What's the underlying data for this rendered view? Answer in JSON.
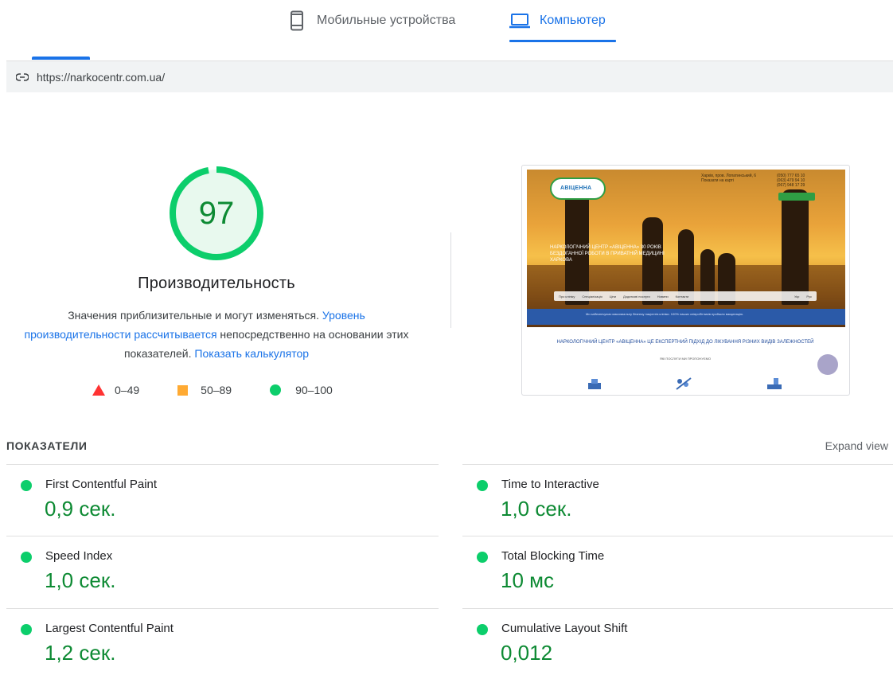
{
  "tabs": {
    "mobile": {
      "label": "Мобильные устройства",
      "icon": "smartphone-icon"
    },
    "desktop": {
      "label": "Компьютер",
      "icon": "laptop-icon",
      "active": true
    }
  },
  "url": {
    "text": "https://narkocentr.com.ua/",
    "icon": "link-icon"
  },
  "performance": {
    "score": "97",
    "score_fraction": 0.97,
    "title": "Производительность",
    "desc_part1": "Значения приблизительные и могут изменяться. ",
    "desc_link1": "Уровень производительности рассчитывается",
    "desc_part2": " непосредственно на основании этих показателей. ",
    "desc_link2": "Показать калькулятор"
  },
  "legend": [
    {
      "range": "0–49",
      "color": "#ff3333",
      "shape": "triangle"
    },
    {
      "range": "50–89",
      "color": "#ffaa33",
      "shape": "square"
    },
    {
      "range": "90–100",
      "color": "#0cce6b",
      "shape": "circle"
    }
  ],
  "thumbnail": {
    "logo": "АВІЦЕННА",
    "address": "Харків, пров. Лопатинський, 6",
    "address_link": "Показати на карті",
    "phones": [
      "(050) 777 65 10",
      "(063) 479 94 10",
      "(067) 948 17 29"
    ],
    "headline": "НАРКОЛОГІЧНИЙ ЦЕНТР «АВІЦЕННА» 30 РОКІВ БЕЗДОГАННОЇ РОБОТИ В ПРИВАТНІЙ МЕДИЦИНІ ХАРКОВА",
    "nav": [
      "Про клініку",
      "Спеціалізація",
      "Ціни",
      "Додаткові послуги",
      "Новини",
      "Контакти"
    ],
    "lang": [
      "Укр",
      "Рус"
    ],
    "band_text": "Ми забезпечуємо максимальну безпеку пацієнтів клініки. 100% наших співробітників пройшли вакцинацію.",
    "title2": "НАРКОЛОГІЧНИЙ ЦЕНТР «АВІЦЕННА» ЦЕ ЕКСПЕРТНИЙ ПІДХІД ДО ЛІКУВАННЯ РІЗНИХ ВИДІВ ЗАЛЕЖНОСТЕЙ",
    "sub2": "ЯКІ ПОСЛУГИ МИ ПРОПОНУЄМО"
  },
  "metrics": {
    "title": "ПОКАЗАТЕЛИ",
    "expand_label": "Expand view",
    "status_color": "#0cce6b",
    "items": [
      {
        "label": "First Contentful Paint",
        "value": "0,9 сек."
      },
      {
        "label": "Time to Interactive",
        "value": "1,0 сек."
      },
      {
        "label": "Speed Index",
        "value": "1,0 сек."
      },
      {
        "label": "Total Blocking Time",
        "value": "10 мс"
      },
      {
        "label": "Largest Contentful Paint",
        "value": "1,2 сек."
      },
      {
        "label": "Cumulative Layout Shift",
        "value": "0,012"
      }
    ]
  }
}
